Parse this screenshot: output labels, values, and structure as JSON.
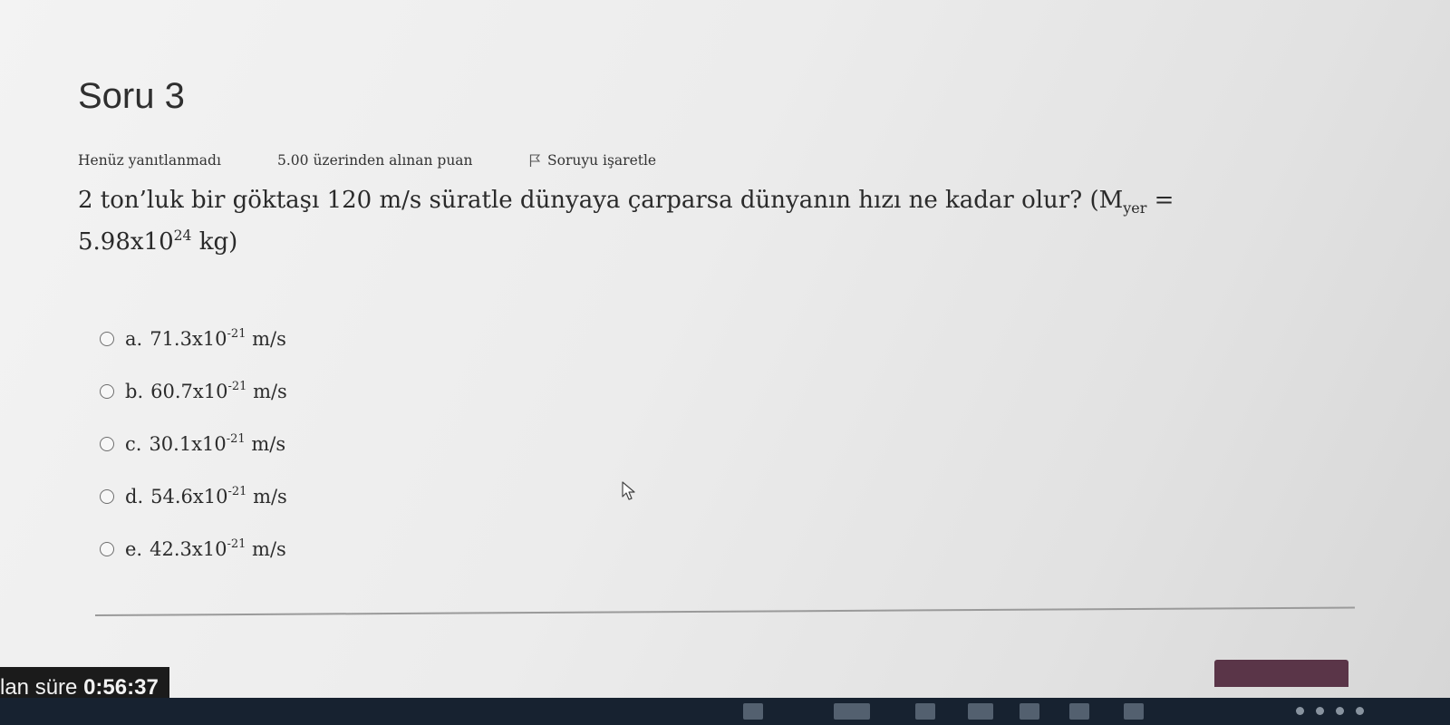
{
  "question": {
    "title": "Soru 3",
    "status": "Henüz yanıtlanmadı",
    "points": "5.00 üzerinden alınan puan",
    "flag_label": "Soruyu işaretle",
    "text_main": "2 ton’luk bir göktaşı 120 m/s süratle dünyaya çarparsa dünyanın hızı ne kadar olur? (M",
    "text_sub": "yer",
    "text_eq": " =",
    "mass_base": "5.98x10",
    "mass_exp": "24",
    "mass_unit": " kg)"
  },
  "answers": [
    {
      "letter": "a.",
      "base": "71.3x10",
      "exp": "-21",
      "unit": " m/s"
    },
    {
      "letter": "b.",
      "base": "60.7x10",
      "exp": "-21",
      "unit": " m/s"
    },
    {
      "letter": "c.",
      "base": "30.1x10",
      "exp": "-21",
      "unit": " m/s"
    },
    {
      "letter": "d.",
      "base": "54.6x10",
      "exp": "-21",
      "unit": " m/s"
    },
    {
      "letter": "e.",
      "base": "42.3x10",
      "exp": "-21",
      "unit": " m/s"
    }
  ],
  "timer": {
    "label": "lan süre ",
    "value": "0:56:37"
  },
  "icons": {
    "flag": "flag-icon",
    "cursor": "mouse-pointer-icon",
    "radio": "radio-unchecked-icon"
  },
  "colors": {
    "timer_bg": "#1b1b1b",
    "next_button": "#5a3548",
    "taskbar": "#172230"
  }
}
